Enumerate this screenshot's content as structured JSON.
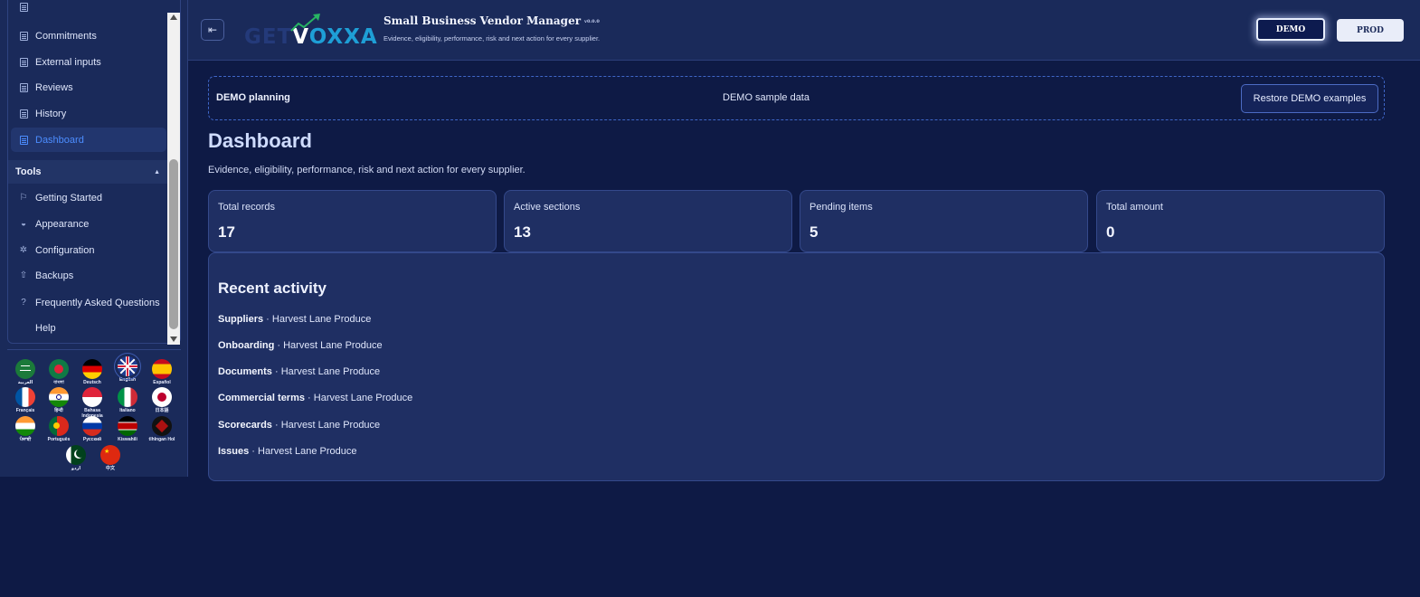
{
  "sidebar": {
    "nav_items": [
      {
        "label": "Commitments"
      },
      {
        "label": "External inputs"
      },
      {
        "label": "Reviews"
      },
      {
        "label": "History"
      },
      {
        "label": "Dashboard",
        "active": true
      }
    ],
    "tools_header": "Tools",
    "tools_items": [
      {
        "label": "Getting Started",
        "icon": "flag-icon"
      },
      {
        "label": "Appearance",
        "icon": "palette-icon"
      },
      {
        "label": "Configuration",
        "icon": "gear-icon"
      },
      {
        "label": "Backups",
        "icon": "upload-icon"
      },
      {
        "label": "Frequently Asked Questions",
        "icon": "question-icon"
      },
      {
        "label": "Help",
        "icon": ""
      }
    ],
    "languages": [
      {
        "code": "ar",
        "label": "العربية"
      },
      {
        "code": "bn",
        "label": "বাংলা"
      },
      {
        "code": "de",
        "label": "Deutsch"
      },
      {
        "code": "en",
        "label": "English",
        "selected": true
      },
      {
        "code": "es",
        "label": "Español"
      },
      {
        "code": "fr",
        "label": "Français"
      },
      {
        "code": "hi",
        "label": "हिन्दी"
      },
      {
        "code": "id",
        "label": "Bahasa Indonesia"
      },
      {
        "code": "it",
        "label": "Italiano"
      },
      {
        "code": "ja",
        "label": "日本語"
      },
      {
        "code": "pa",
        "label": "ਪੰਜਾਬੀ"
      },
      {
        "code": "pt",
        "label": "Português"
      },
      {
        "code": "ru",
        "label": "Русский"
      },
      {
        "code": "sw",
        "label": "Kiswahili"
      },
      {
        "code": "tlh",
        "label": "tlhIngan Hol"
      },
      {
        "code": "ur",
        "label": "اردو"
      },
      {
        "code": "zh",
        "label": "中文"
      }
    ]
  },
  "header": {
    "logo_parts": [
      "GET",
      "V",
      "OXXA"
    ],
    "app_title": "Small Business Vendor Manager",
    "version": "v0.0.0",
    "subtitle": "Evidence, eligibility, performance, risk and next action for every supplier.",
    "demo_label": "DEMO",
    "prod_label": "PROD"
  },
  "planning": {
    "title": "DEMO planning",
    "center_text": "DEMO sample data",
    "restore_label": "Restore DEMO examples"
  },
  "page": {
    "title": "Dashboard",
    "subtitle": "Evidence, eligibility, performance, risk and next action for every supplier."
  },
  "stats": [
    {
      "label": "Total records",
      "value": "17"
    },
    {
      "label": "Active sections",
      "value": "13"
    },
    {
      "label": "Pending items",
      "value": "5"
    },
    {
      "label": "Total amount",
      "value": "0"
    }
  ],
  "activity": {
    "title": "Recent activity",
    "separator": " · ",
    "rows": [
      {
        "section": "Suppliers",
        "item": "Harvest Lane Produce"
      },
      {
        "section": "Onboarding",
        "item": "Harvest Lane Produce"
      },
      {
        "section": "Documents",
        "item": "Harvest Lane Produce"
      },
      {
        "section": "Commercial terms",
        "item": "Harvest Lane Produce"
      },
      {
        "section": "Scorecards",
        "item": "Harvest Lane Produce"
      },
      {
        "section": "Issues",
        "item": "Harvest Lane Produce"
      }
    ]
  }
}
